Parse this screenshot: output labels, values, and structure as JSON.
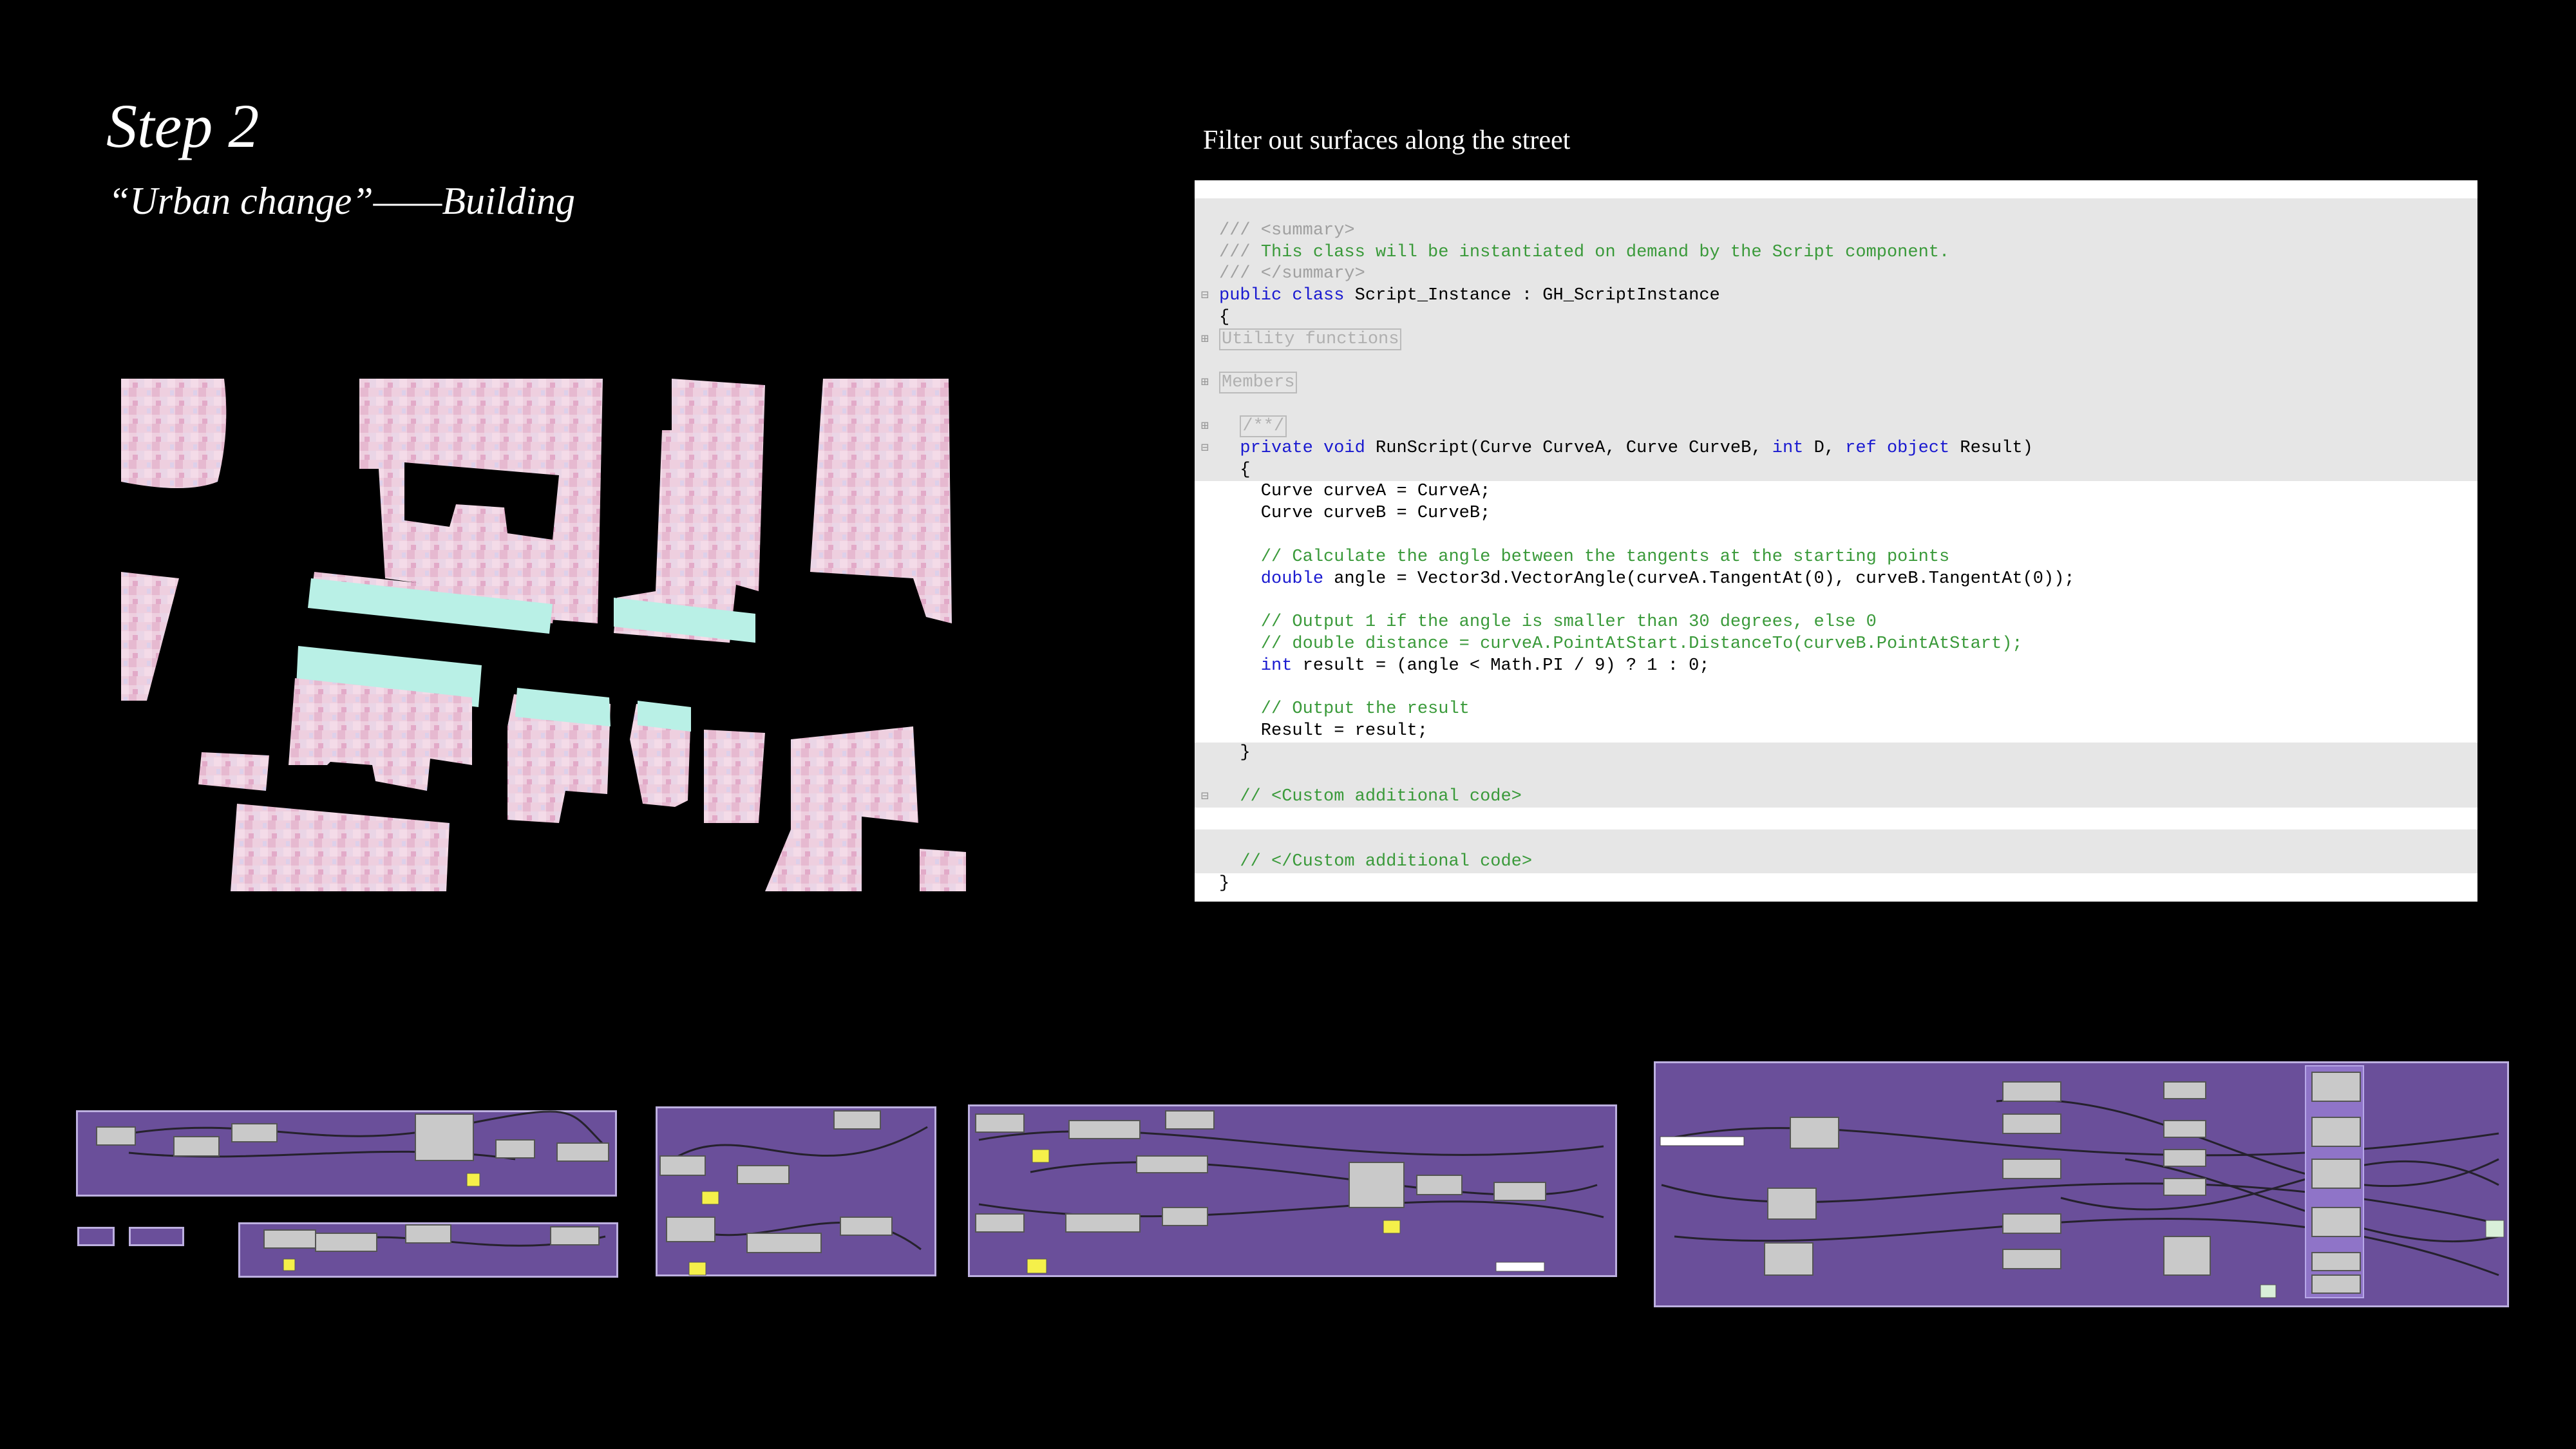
{
  "slide": {
    "title": "Step 2",
    "subtitle": "“Urban change”——Building",
    "caption": "Filter out surfaces along the street"
  },
  "code": [
    {
      "gray": true,
      "gutter": "",
      "segs": []
    },
    {
      "gray": true,
      "gutter": "",
      "segs": [
        {
          "c": "doc",
          "t": "/// <summary>"
        }
      ]
    },
    {
      "gray": true,
      "gutter": "",
      "segs": [
        {
          "c": "doc",
          "t": "/// "
        },
        {
          "c": "comment",
          "t": "This class will be instantiated on demand by the Script component."
        }
      ]
    },
    {
      "gray": true,
      "gutter": "",
      "segs": [
        {
          "c": "doc",
          "t": "/// </summary>"
        }
      ]
    },
    {
      "gray": true,
      "gutter": "⊟",
      "segs": [
        {
          "c": "keyword",
          "t": "public class "
        },
        {
          "c": "default",
          "t": "Script_Instance : GH_ScriptInstance"
        }
      ]
    },
    {
      "gray": true,
      "gutter": "",
      "segs": [
        {
          "c": "default",
          "t": "{"
        }
      ]
    },
    {
      "gray": true,
      "gutter": "⊞",
      "segs": [
        {
          "c": "region",
          "t": "Utility functions"
        }
      ]
    },
    {
      "gray": true,
      "gutter": "",
      "segs": []
    },
    {
      "gray": true,
      "gutter": "⊞",
      "segs": [
        {
          "c": "region",
          "t": "Members"
        }
      ]
    },
    {
      "gray": true,
      "gutter": "",
      "segs": []
    },
    {
      "gray": true,
      "gutter": "⊞",
      "segs": [
        {
          "c": "default",
          "t": "  "
        },
        {
          "c": "region",
          "t": "/**/"
        }
      ]
    },
    {
      "gray": true,
      "gutter": "⊟",
      "segs": [
        {
          "c": "default",
          "t": "  "
        },
        {
          "c": "keyword",
          "t": "private void "
        },
        {
          "c": "default",
          "t": "RunScript(Curve CurveA, Curve CurveB, "
        },
        {
          "c": "keyword",
          "t": "int "
        },
        {
          "c": "default",
          "t": "D, "
        },
        {
          "c": "keyword",
          "t": "ref object "
        },
        {
          "c": "default",
          "t": "Result)"
        }
      ]
    },
    {
      "gray": true,
      "gutter": "",
      "segs": [
        {
          "c": "default",
          "t": "  {"
        }
      ]
    },
    {
      "gray": false,
      "gutter": "",
      "segs": [
        {
          "c": "default",
          "t": "    Curve curveA = CurveA;"
        }
      ]
    },
    {
      "gray": false,
      "gutter": "",
      "segs": [
        {
          "c": "default",
          "t": "    Curve curveB = CurveB;"
        }
      ]
    },
    {
      "gray": false,
      "gutter": "",
      "segs": []
    },
    {
      "gray": false,
      "gutter": "",
      "segs": [
        {
          "c": "comment",
          "t": "    // Calculate the angle between the tangents at the starting points"
        }
      ]
    },
    {
      "gray": false,
      "gutter": "",
      "segs": [
        {
          "c": "keyword",
          "t": "    double "
        },
        {
          "c": "default",
          "t": "angle = Vector3d.VectorAngle(curveA.TangentAt(0), curveB.TangentAt(0));"
        }
      ]
    },
    {
      "gray": false,
      "gutter": "",
      "segs": []
    },
    {
      "gray": false,
      "gutter": "",
      "segs": [
        {
          "c": "comment",
          "t": "    // Output 1 if the angle is smaller than 30 degrees, else 0"
        }
      ]
    },
    {
      "gray": false,
      "gutter": "",
      "segs": [
        {
          "c": "comment",
          "t": "    // double distance = curveA.PointAtStart.DistanceTo(curveB.PointAtStart);"
        }
      ]
    },
    {
      "gray": false,
      "gutter": "",
      "segs": [
        {
          "c": "keyword",
          "t": "    int "
        },
        {
          "c": "default",
          "t": "result = (angle < Math.PI / 9) ? 1 : 0;"
        }
      ]
    },
    {
      "gray": false,
      "gutter": "",
      "segs": []
    },
    {
      "gray": false,
      "gutter": "",
      "segs": [
        {
          "c": "comment",
          "t": "    // Output the result"
        }
      ]
    },
    {
      "gray": false,
      "gutter": "",
      "segs": [
        {
          "c": "default",
          "t": "    Result = result;"
        }
      ]
    },
    {
      "gray": true,
      "gutter": "",
      "segs": [
        {
          "c": "default",
          "t": "  }"
        }
      ]
    },
    {
      "gray": true,
      "gutter": "",
      "segs": []
    },
    {
      "gray": true,
      "gutter": "⊟",
      "segs": [
        {
          "c": "comment",
          "t": "  // <Custom additional code>"
        }
      ]
    },
    {
      "gray": false,
      "gutter": "",
      "segs": []
    },
    {
      "gray": true,
      "gutter": "",
      "segs": []
    },
    {
      "gray": true,
      "gutter": "",
      "segs": [
        {
          "c": "comment",
          "t": "  // </Custom additional code>"
        }
      ]
    },
    {
      "gray": false,
      "gutter": "",
      "segs": [
        {
          "c": "default",
          "t": "}"
        }
      ]
    }
  ],
  "colors": {
    "background": "#000000",
    "canvas": "#6a4f9a",
    "building_pink": "#eecfdf",
    "facade_cyan": "#b9f0e6",
    "comment_green": "#3a9a3a",
    "keyword_blue": "#1a1ad0"
  },
  "icons": [
    "grasshopper-node-icon",
    "yellow-panel-icon"
  ]
}
